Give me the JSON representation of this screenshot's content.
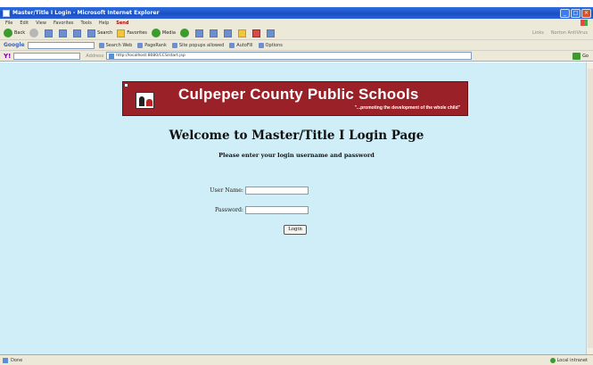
{
  "window": {
    "title": "Master/Title I Login - Microsoft Internet Explorer",
    "buttons": [
      "_",
      "□",
      "×"
    ]
  },
  "menu": {
    "items": [
      "File",
      "Edit",
      "View",
      "Favorites",
      "Tools",
      "Help"
    ],
    "send_label": "Send"
  },
  "toolbar": {
    "back_label": "Back",
    "search_label": "Search",
    "favorites_label": "Favorites",
    "media_label": "Media",
    "links_label": "Links",
    "norton_label": "Norton AntiVirus"
  },
  "google_bar": {
    "logo": "Google",
    "search_web_label": "Search Web",
    "pagerank_label": "PageRank",
    "popups_label": "Site popups allowed",
    "autofill_label": "AutoFill",
    "options_label": "Options"
  },
  "address_bar": {
    "yahoo_logo": "Y!",
    "label": "Address",
    "url": "http://localhost:8080/CCS/start.jsp",
    "go_label": "Go"
  },
  "banner": {
    "title": "Culpeper County Public Schools",
    "tagline": "\"...promoting the development of the whole child\""
  },
  "page": {
    "heading": "Welcome to Master/Title I Login Page",
    "subheading": "Please enter your login username and password",
    "username_label": "User Name:",
    "username_value": "",
    "password_label": "Password:",
    "password_value": "",
    "login_button": "Login"
  },
  "status": {
    "left": "Done",
    "right": "Local intranet"
  }
}
